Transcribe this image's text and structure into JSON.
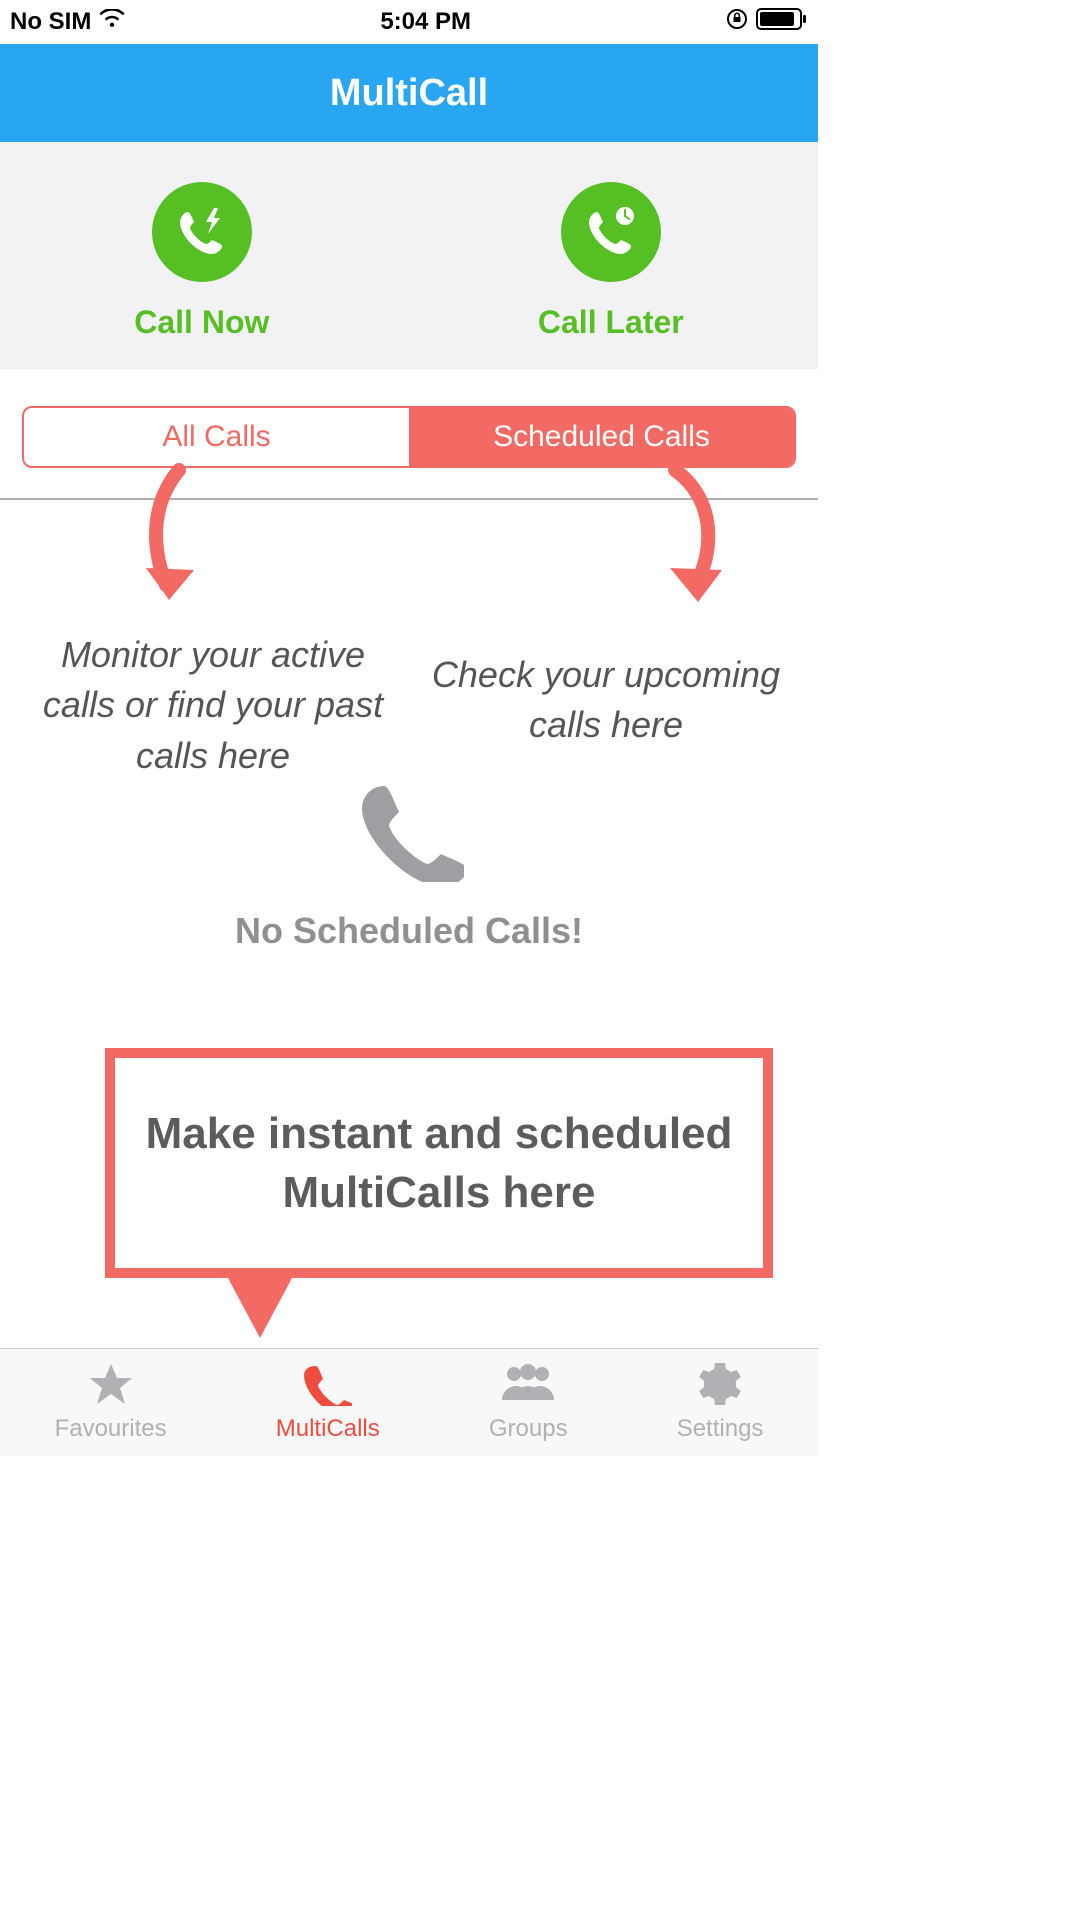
{
  "statusBar": {
    "carrier": "No SIM",
    "time": "5:04 PM"
  },
  "header": {
    "title": "MultiCall"
  },
  "actions": {
    "callNow": "Call Now",
    "callLater": "Call Later"
  },
  "segments": {
    "all": "All Calls",
    "scheduled": "Scheduled Calls"
  },
  "hints": {
    "left": "Monitor your active calls or find your past calls here",
    "right": "Check your upcoming calls here",
    "empty": "No Scheduled Calls!"
  },
  "callout": {
    "text": "Make instant and scheduled MultiCalls here"
  },
  "tabs": {
    "favourites": "Favourites",
    "multicalls": "MultiCalls",
    "groups": "Groups",
    "settings": "Settings"
  }
}
